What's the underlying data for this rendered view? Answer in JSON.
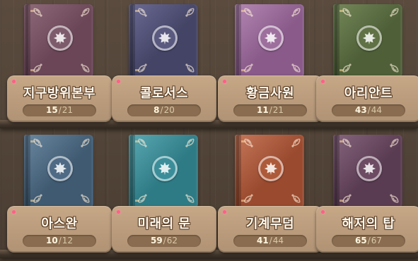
{
  "books": [
    {
      "title": "지구방위본부",
      "collected": "15",
      "total": "21",
      "cover": "#6a4657",
      "accent": "#8f6a7a",
      "emblem": "#7d5b6b"
    },
    {
      "title": "콜로서스",
      "collected": "8",
      "total": "20",
      "cover": "#444466",
      "accent": "#6b6b95",
      "emblem": "#5a5a80"
    },
    {
      "title": "황금사원",
      "collected": "11",
      "total": "21",
      "cover": "#8a5b8a",
      "accent": "#b387b3",
      "emblem": "#9d6f9d"
    },
    {
      "title": "아리안트",
      "collected": "43",
      "total": "44",
      "cover": "#4f6038",
      "accent": "#74885a",
      "emblem": "#5f7145"
    },
    {
      "title": "아스완",
      "collected": "10",
      "total": "12",
      "cover": "#3f5a71",
      "accent": "#6a88a1",
      "emblem": "#4e6a84"
    },
    {
      "title": "미래의 문",
      "collected": "59",
      "total": "62",
      "cover": "#2f7b85",
      "accent": "#5aa9b3",
      "emblem": "#3b8e99"
    },
    {
      "title": "기계무덤",
      "collected": "41",
      "total": "44",
      "cover": "#9a4a2e",
      "accent": "#c6775a",
      "emblem": "#ad5a3b"
    },
    {
      "title": "해저의 탑",
      "collected": "65",
      "total": "67",
      "cover": "#5a3c52",
      "accent": "#86657e",
      "emblem": "#6c4b63"
    }
  ],
  "icons": {
    "emblem": "maple-leaf-icon",
    "new_marker": "pink-dot-icon",
    "corner": "ornament-icon"
  }
}
